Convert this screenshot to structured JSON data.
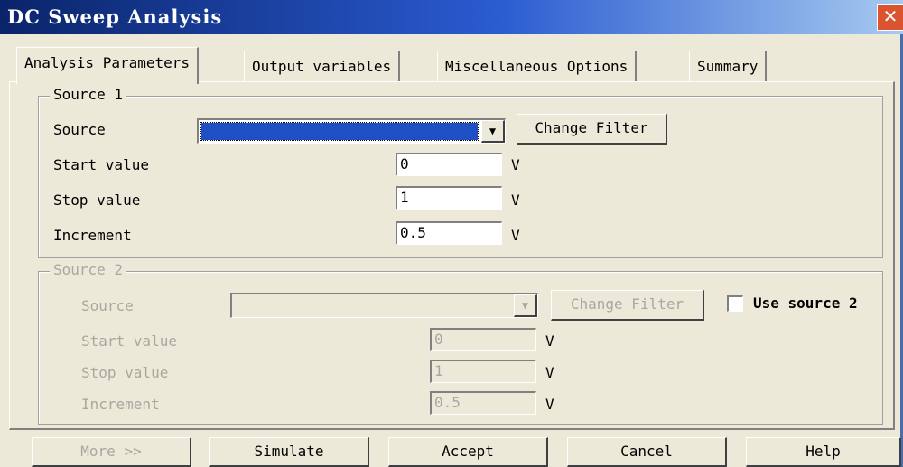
{
  "window": {
    "title": "DC Sweep Analysis",
    "close_icon": "close-icon"
  },
  "tabs": [
    {
      "label": "Analysis Parameters",
      "active": true
    },
    {
      "label": "Output variables",
      "active": false
    },
    {
      "label": "Miscellaneous Options",
      "active": false
    },
    {
      "label": "Summary",
      "active": false
    }
  ],
  "source1": {
    "legend": "Source 1",
    "source_label": "Source",
    "change_filter": "Change Filter",
    "start_label": "Start value",
    "start_value": "0",
    "stop_label": "Stop value",
    "stop_value": "1",
    "increment_label": "Increment",
    "increment_value": "0.5",
    "unit": "V"
  },
  "source2": {
    "legend": "Source 2",
    "source_label": "Source",
    "change_filter": "Change Filter",
    "use_source_label": "Use source 2",
    "use_source_checked": false,
    "start_label": "Start value",
    "start_value": "0",
    "stop_label": "Stop value",
    "stop_value": "1",
    "increment_label": "Increment",
    "increment_value": "0.5",
    "unit": "V"
  },
  "buttons": {
    "more": "More >>",
    "simulate": "Simulate",
    "accept": "Accept",
    "cancel": "Cancel",
    "help": "Help"
  },
  "colors": {
    "titlebar": "#0a246a",
    "face": "#ece9d8",
    "selection": "#1f4fc4"
  }
}
